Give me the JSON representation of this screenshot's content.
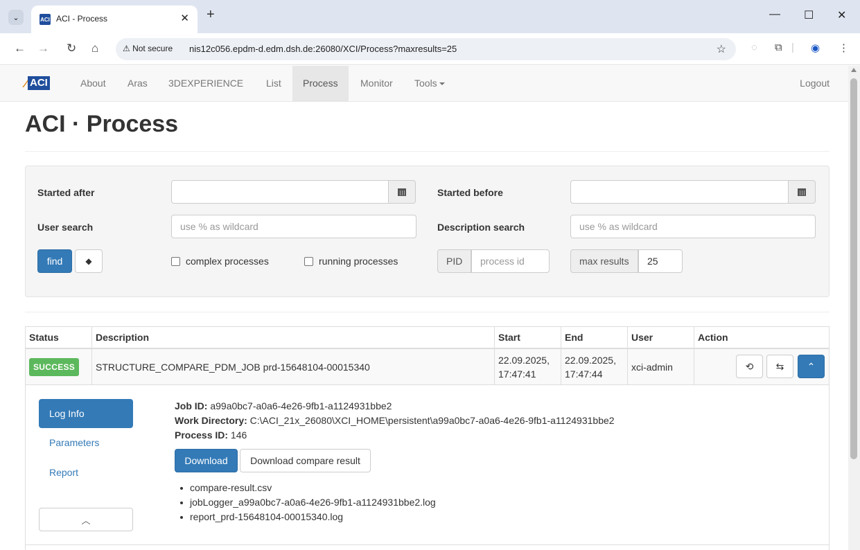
{
  "browser": {
    "tab_title": "ACI - Process",
    "favicon_text": "ACI",
    "not_secure": "Not secure",
    "url": "nis12c056.epdm-d.edm.dsh.de:26080/XCI/Process?maxresults=25"
  },
  "navbar": {
    "brand": "ACI",
    "items": [
      {
        "label": "About"
      },
      {
        "label": "Aras"
      },
      {
        "label": "3DEXPERIENCE"
      },
      {
        "label": "List"
      },
      {
        "label": "Process"
      },
      {
        "label": "Monitor"
      },
      {
        "label": "Tools"
      }
    ],
    "logout": "Logout"
  },
  "page": {
    "title_bold": "ACI",
    "title_rest": " · Process"
  },
  "search": {
    "started_after_label": "Started after",
    "started_after_value": "",
    "started_before_label": "Started before",
    "started_before_value": "",
    "user_search_label": "User search",
    "user_search_placeholder": "use % as wildcard",
    "description_search_label": "Description search",
    "description_search_placeholder": "use % as wildcard",
    "find_label": "find",
    "complex_processes_label": "complex processes",
    "running_processes_label": "running processes",
    "pid_label": "PID",
    "pid_placeholder": "process id",
    "max_results_label": "max results",
    "max_results_value": "25"
  },
  "table": {
    "headers": [
      "Status",
      "Description",
      "Start",
      "End",
      "User",
      "Action"
    ],
    "rows": [
      {
        "status": "SUCCESS",
        "description": "STRUCTURE_COMPARE_PDM_JOB prd-15648104-00015340",
        "start_date": "22.09.2025,",
        "start_time": "17:47:41",
        "end_date": "22.09.2025,",
        "end_time": "17:47:44",
        "user": "xci-admin"
      }
    ]
  },
  "detail": {
    "tabs": [
      "Log Info",
      "Parameters",
      "Report"
    ],
    "job_id_label": "Job ID:",
    "job_id": " a99a0bc7-a0a6-4e26-9fb1-a1124931bbe2",
    "work_dir_label": "Work Directory:",
    "work_dir": " C:\\ACI_21x_26080\\XCI_HOME\\persistent\\a99a0bc7-a0a6-4e26-9fb1-a1124931bbe2",
    "process_id_label": "Process ID:",
    "process_id": " 146",
    "download_label": "Download",
    "download_compare_label": "Download compare result",
    "files": [
      "compare-result.csv",
      "jobLogger_a99a0bc7-a0a6-4e26-9fb1-a1124931bbe2.log",
      "report_prd-15648104-00015340.log"
    ]
  },
  "colors": {
    "primary": "#337ab7",
    "success": "#5cb85c",
    "brand_blue": "#1f4e9c",
    "brand_orange": "#e08a1e"
  }
}
